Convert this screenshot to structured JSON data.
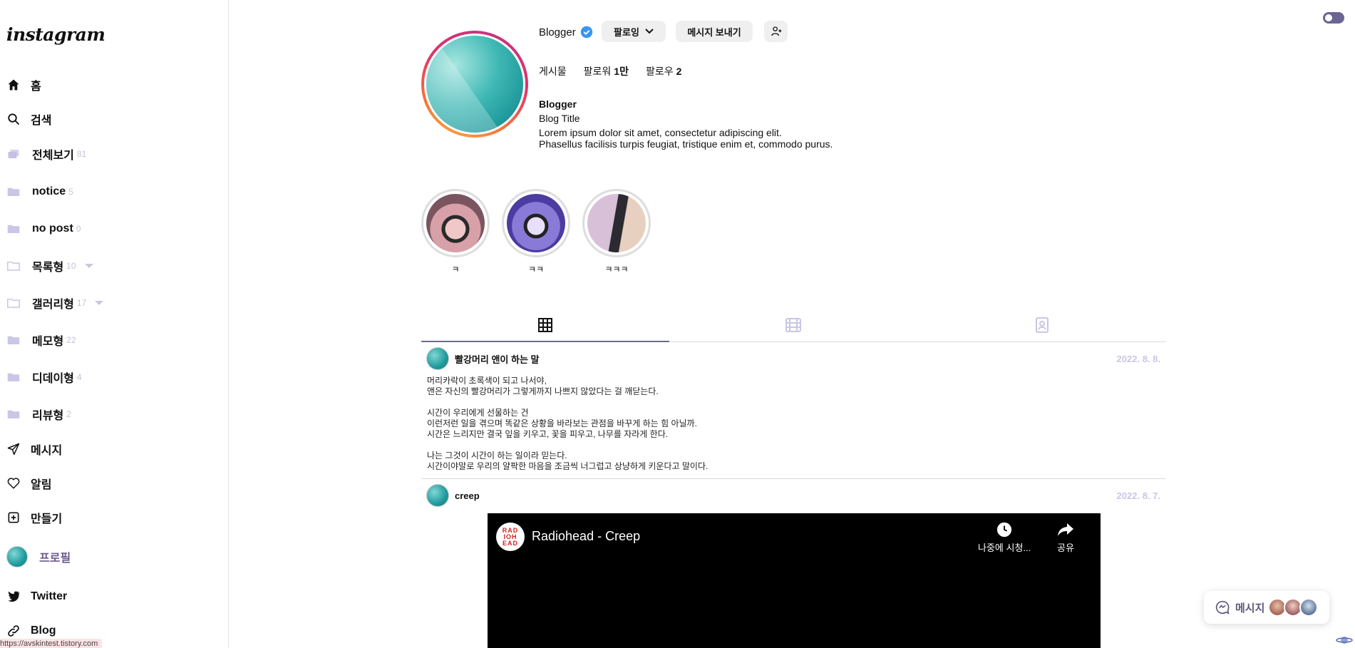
{
  "sidebar": {
    "logo": "instagram",
    "items": [
      {
        "label": "홈",
        "icon": "home-icon"
      },
      {
        "label": "검색",
        "icon": "search-icon"
      },
      {
        "label": "전체보기",
        "count": "81",
        "icon": "stack-icon"
      },
      {
        "label": "notice",
        "count": "5",
        "icon": "folder-icon"
      },
      {
        "label": "no post",
        "count": "0",
        "icon": "folder-icon"
      },
      {
        "label": "목록형",
        "count": "10",
        "icon": "folder-open-icon"
      },
      {
        "label": "갤러리형",
        "count": "17",
        "icon": "folder-open-icon"
      },
      {
        "label": "메모형",
        "count": "22",
        "icon": "folder-icon"
      },
      {
        "label": "디데이형",
        "count": "4",
        "icon": "folder-icon"
      },
      {
        "label": "리뷰형",
        "count": "2",
        "icon": "folder-icon"
      },
      {
        "label": "메시지",
        "icon": "send-icon"
      },
      {
        "label": "알림",
        "icon": "heart-icon"
      },
      {
        "label": "만들기",
        "icon": "plus-square-icon"
      },
      {
        "label": "프로필",
        "icon": "avatar"
      },
      {
        "label": "Twitter",
        "icon": "twitter-icon"
      },
      {
        "label": "Blog",
        "icon": "link-icon"
      }
    ]
  },
  "status_url": "https://avskintest.tistory.com",
  "profile": {
    "username": "Blogger",
    "follow_button": "팔로잉",
    "message_button": "메시지 보내기",
    "stats": {
      "posts_label": "게시물",
      "followers_label": "팔로워",
      "followers_value": "1만",
      "following_label": "팔로우",
      "following_value": "2"
    },
    "bio_name": "Blogger",
    "bio_title": "Blog Title",
    "bio_line1": "Lorem ipsum dolor sit amet, consectetur adipiscing elit.",
    "bio_line2": "Phasellus facilisis turpis feugiat, tristique enim et, commodo purus."
  },
  "highlights": [
    {
      "label": "ㅋ"
    },
    {
      "label": "ㅋㅋ"
    },
    {
      "label": "ㅋㅋㅋ"
    }
  ],
  "posts": [
    {
      "title": "빨강머리 앤이 하는 말",
      "date": "2022. 8. 8.",
      "p1_l1": "머리카락이 초록색이 되고 나서야,",
      "p1_l2": "앤은 자신의 빨강머리가 그렇게까지 나쁘지 않았다는 걸 깨닫는다.",
      "p2_l1": "시간이 우리에게 선물하는 건",
      "p2_l2": "이런저런 일을 겪으며 똑같은 상황을 바라보는 관점을 바꾸게 하는 힘 아닐까.",
      "p2_l3": "시간은 느리지만 결국 잎을 키우고, 꽃을 피우고, 나무를 자라게 한다.",
      "p3_l1": "나는 그것이 시간이 하는 일이라 믿는다.",
      "p3_l2": "시간이야말로 우리의 얄팍한 마음을 조금씩 너그럽고 상냥하게 키운다고 말이다."
    },
    {
      "title": "creep",
      "date": "2022. 8. 7.",
      "video": {
        "logo_text": "RAD IOH EAD",
        "title": "Radiohead - Creep",
        "watch_later": "나중에 시청...",
        "share": "공유"
      }
    }
  ],
  "message_widget": {
    "label": "메시지"
  },
  "colors": {
    "accent": "#6b6592",
    "date": "#c9c6e6",
    "count": "#c3c3d6"
  }
}
